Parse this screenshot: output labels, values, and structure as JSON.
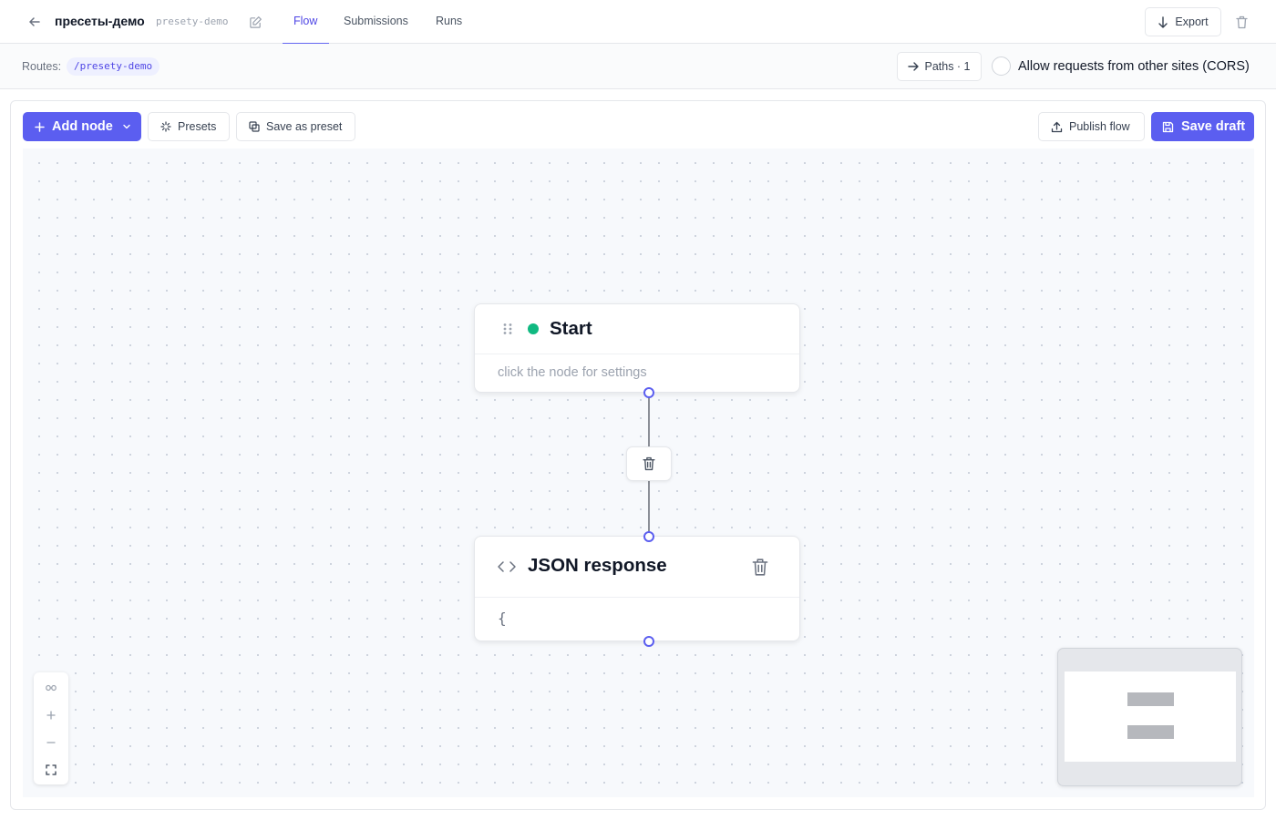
{
  "header": {
    "title": "пресеты-демо",
    "slug": "presety-demo",
    "tabs": [
      {
        "label": "Flow",
        "active": true
      },
      {
        "label": "Submissions",
        "active": false
      },
      {
        "label": "Runs",
        "active": false
      }
    ],
    "export_label": "Export"
  },
  "routes": {
    "label": "Routes:",
    "items": [
      "/presety-demo"
    ],
    "paths_label": "Paths · 1",
    "cors_label": "Allow requests from other sites (CORS)",
    "cors_checked": false
  },
  "toolbar": {
    "add_node_label": "Add node",
    "presets_label": "Presets",
    "save_preset_label": "Save as preset",
    "publish_label": "Publish flow",
    "save_draft_label": "Save draft"
  },
  "nodes": [
    {
      "title": "Start",
      "hint": "click the node for settings",
      "status_color": "#10b981"
    },
    {
      "title": "JSON response",
      "body": "{"
    }
  ],
  "colors": {
    "accent": "#5b5ef0",
    "status_active": "#10b981"
  },
  "icons": {
    "back": "arrow-left-icon",
    "edit": "pencil-square-icon",
    "export": "arrow-down-icon",
    "delete": "trash-icon",
    "paths": "arrow-right-icon",
    "add": "plus-icon",
    "presets": "sparkle-icon",
    "save_preset": "copy-icon",
    "publish": "upload-icon",
    "save": "floppy-disk-icon",
    "drag": "grip-dots-icon",
    "code": "code-brackets-icon",
    "zoom_in": "plus-icon",
    "zoom_out": "minus-icon",
    "fit": "fullscreen-icon"
  }
}
